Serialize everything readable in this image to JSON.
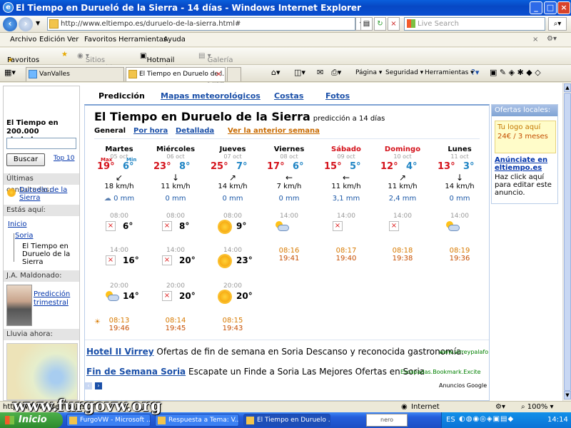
{
  "window": {
    "title": "El Tiempo en Durueló de la Sierra - 14 días - Windows Internet Explorer"
  },
  "address": {
    "url": "http://www.eltiempo.es/duruelo-de-la-sierra.html#",
    "search_placeholder": "Live Search"
  },
  "menu": [
    "Archivo",
    "Edición",
    "Ver",
    "Favoritos",
    "Herramientas",
    "Ayuda"
  ],
  "favbar": {
    "favorites": "Favoritos",
    "suggested": "Sitios sugeridos",
    "hotmail": "Hotmail gratuito",
    "gallery": "Galería de Web Slice"
  },
  "tabs": [
    "VanValles",
    "El Tiempo en Duruelo de l..."
  ],
  "commands": [
    "Página",
    "Seguridad",
    "Herramientas"
  ],
  "topnav": [
    "Predicción",
    "Mapas meteorológicos",
    "Costas",
    "Fotos"
  ],
  "sidebar": {
    "search_title": "El Tiempo en 200.000 ciudades:",
    "search_button": "Buscar",
    "top10": "Top 10",
    "recent_head": "Últimas consultadas:",
    "recent_item": "Duruelo de la Sierra",
    "here_head": "Estás aquí:",
    "crumb1": "Inicio",
    "crumb2": "Soria",
    "crumb3": "El Tiempo en Duruelo de la Sierra",
    "author_head": "J.A. Maldonado:",
    "author_link": "Predicción trimestral",
    "rain_head": "Lluvia ahora:"
  },
  "page": {
    "title": "El Tiempo en Duruelo de la Sierra",
    "subtitle": "predicción a 14 días",
    "subnav": [
      "General",
      "Por hora",
      "Detallada",
      "Ver la anterior semana"
    ],
    "max_label": "Max",
    "min_label": "Min"
  },
  "days": [
    {
      "name": "Martes",
      "date": "05 oct",
      "max": "19°",
      "min": "6°",
      "wind": "18 km/h",
      "rain": "0 mm",
      "weekend": false
    },
    {
      "name": "Miércoles",
      "date": "06 oct",
      "max": "23°",
      "min": "8°",
      "wind": "11 km/h",
      "rain": "0 mm",
      "weekend": false
    },
    {
      "name": "Jueves",
      "date": "07 oct",
      "max": "25°",
      "min": "7°",
      "wind": "14 km/h",
      "rain": "0 mm",
      "weekend": false
    },
    {
      "name": "Viernes",
      "date": "08 oct",
      "max": "17°",
      "min": "6°",
      "wind": "7 km/h",
      "rain": "0 mm",
      "weekend": false
    },
    {
      "name": "Sábado",
      "date": "09 oct",
      "max": "15°",
      "min": "5°",
      "wind": "11 km/h",
      "rain": "3,1 mm",
      "weekend": true
    },
    {
      "name": "Domingo",
      "date": "10 oct",
      "max": "12°",
      "min": "4°",
      "wind": "11 km/h",
      "rain": "2,4 mm",
      "weekend": true
    },
    {
      "name": "Lunes",
      "date": "11 oct",
      "max": "13°",
      "min": "3°",
      "wind": "14 km/h",
      "rain": "0 mm",
      "weekend": false
    }
  ],
  "slots": {
    "row1": [
      {
        "hr": "08:00",
        "t": "6°"
      },
      {
        "hr": "08:00",
        "t": "8°"
      },
      {
        "hr": "08:00",
        "t": "9°"
      },
      {
        "hr": "14:00",
        "t": ""
      },
      {
        "hr": "14:00",
        "t": ""
      },
      {
        "hr": "14:00",
        "t": ""
      },
      {
        "hr": "14:00",
        "t": ""
      }
    ],
    "row2": [
      {
        "hr": "14:00",
        "t": "16°"
      },
      {
        "hr": "14:00",
        "t": "20°"
      },
      {
        "hr": "14:00",
        "t": "23°"
      }
    ],
    "row3": [
      {
        "hr": "20:00",
        "t": "14°"
      },
      {
        "hr": "20:00",
        "t": "20°"
      },
      {
        "hr": "20:00",
        "t": "20°"
      }
    ]
  },
  "sun_times": [
    {
      "rise": "08:13",
      "set": "19:46"
    },
    {
      "rise": "08:14",
      "set": "19:45"
    },
    {
      "rise": "08:15",
      "set": "19:43"
    },
    {
      "rise": "08:16",
      "set": "19:41"
    },
    {
      "rise": "08:17",
      "set": "19:40"
    },
    {
      "rise": "08:18",
      "set": "19:38"
    },
    {
      "rise": "08:19",
      "set": "19:36"
    }
  ],
  "ads": [
    {
      "title": "Hotel II Virrey",
      "text": "Ofertas de fin de semana en Soria Descanso y reconocida gastronomía.",
      "url": "www.virreypalafo"
    },
    {
      "title": "Fin de Semana Soria",
      "text": "Escapate un Finde a Soria Las Mejores Ofertas en Soria",
      "url": "Escapadas.Bookmark.Excite"
    }
  ],
  "ads_by": "Anuncios Google",
  "right": {
    "head": "Ofertas locales:",
    "logo_text": "Tu logo aquí",
    "price": "24€ / 3 meses",
    "cta": "Anúnciate en eltiempo.es",
    "cta_desc": "Haz click aquí para editar este anuncio."
  },
  "status": {
    "left": "http://www.eltiempo.es/...",
    "zone": "Internet",
    "zoom": "100%"
  },
  "taskbar": {
    "start": "Inicio",
    "items": [
      "FurgoVW - Microsoft ...",
      "Respuesta a Tema: V...",
      "El Tiempo en Duruelo ..."
    ],
    "lang": "ES",
    "clock": "14:14"
  },
  "watermark": "www.furgovw.org",
  "colors": {
    "accent": "#1a4fa8",
    "max": "#d4121b",
    "min": "#1e84c4"
  }
}
